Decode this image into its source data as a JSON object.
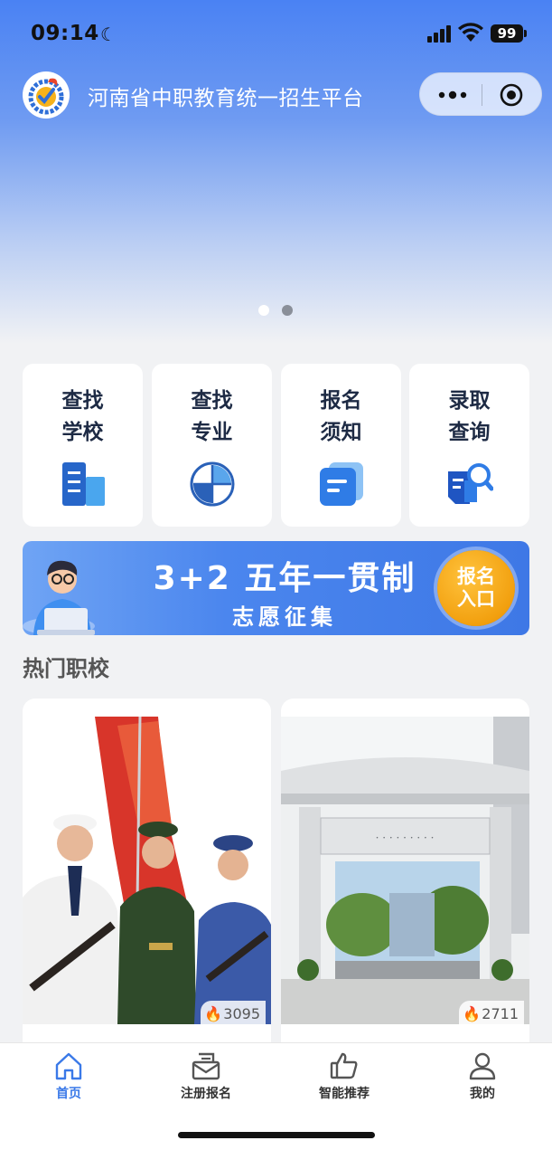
{
  "status_bar": {
    "time": "09:14",
    "battery": "99"
  },
  "header": {
    "title": "河南省中职教育统一招生平台"
  },
  "carousel": {
    "pages": 2,
    "active": 0
  },
  "quick_links": [
    {
      "line1": "查找",
      "line2": "学校",
      "icon": "building-icon"
    },
    {
      "line1": "查找",
      "line2": "专业",
      "icon": "pie-chart-icon"
    },
    {
      "line1": "报名",
      "line2": "须知",
      "icon": "document-icon"
    },
    {
      "line1": "录取",
      "line2": "查询",
      "icon": "search-doc-icon"
    }
  ],
  "banner": {
    "headline": "3+2 五年一贯制",
    "subline": "志愿征集",
    "button_line1": "报名",
    "button_line2": "入口"
  },
  "section": {
    "title": "热门职校"
  },
  "schools": [
    {
      "views": "3095",
      "image": "honor-guard-photo"
    },
    {
      "views": "2711",
      "image": "school-gate-photo"
    }
  ],
  "tabs": [
    {
      "label": "首页",
      "icon": "home-icon",
      "active": true
    },
    {
      "label": "注册报名",
      "icon": "mail-icon",
      "active": false
    },
    {
      "label": "智能推荐",
      "icon": "thumbs-up-icon",
      "active": false
    },
    {
      "label": "我的",
      "icon": "user-icon",
      "active": false
    }
  ],
  "colors": {
    "accent": "#4a82f3",
    "tab_active": "#3a79e8",
    "icon_blue": "#2e6fe0"
  }
}
